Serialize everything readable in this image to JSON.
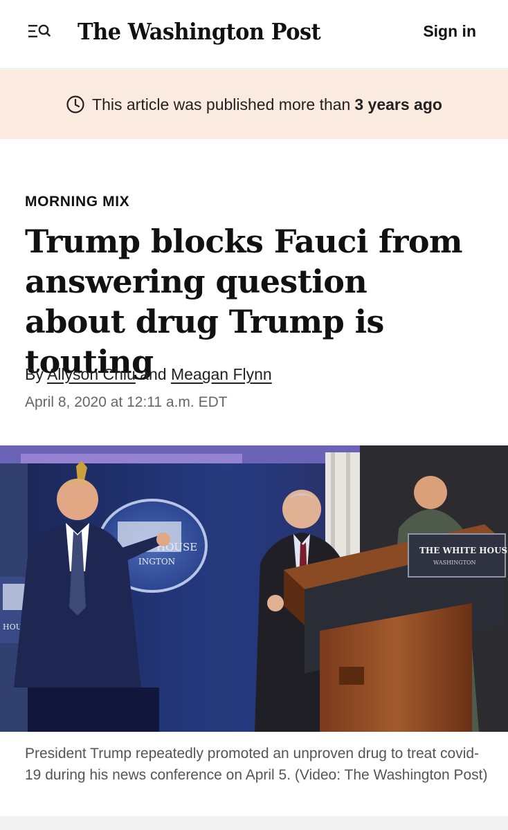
{
  "header": {
    "logo_text": "The Washington Post",
    "signin_label": "Sign in",
    "menu_icon": "menu-search-icon"
  },
  "notice": {
    "text": "This article was published more than",
    "emphasis": "3 years ago",
    "icon": "clock-icon"
  },
  "article": {
    "kicker": "MORNING MIX",
    "headline": "Trump blocks Fauci from answering question about drug Trump is touting",
    "byline_prefix": "By",
    "author1": "Allyson Chiu",
    "byline_and": "and",
    "author2": "Meagan Flynn",
    "date": "April 8, 2020 at 12:11 a.m. EDT"
  },
  "photo": {
    "seal_text": "HOUSE",
    "seal_subtext": "INGTON",
    "side_sign": "HOUSE",
    "podium_line1": "THE WHITE HOUSE",
    "podium_line2": "WASHINGTON"
  },
  "caption": "President Trump repeatedly promoted an unproven drug to treat covid-19 during his news conference on April 5. (Video: The Washington Post)"
}
